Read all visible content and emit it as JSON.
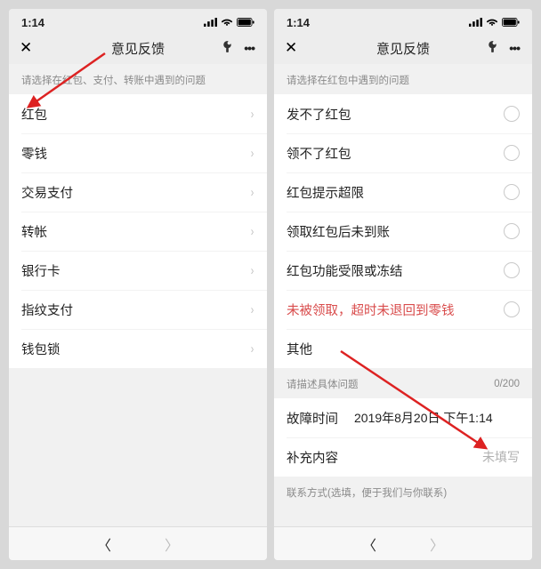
{
  "status": {
    "time": "1:14"
  },
  "nav": {
    "title": "意见反馈"
  },
  "left": {
    "section_header": "请选择在红包、支付、转账中遇到的问题",
    "items": [
      "红包",
      "零钱",
      "交易支付",
      "转帐",
      "银行卡",
      "指纹支付",
      "钱包锁"
    ]
  },
  "right": {
    "section_header": "请选择在红包中遇到的问题",
    "items": [
      "发不了红包",
      "领不了红包",
      "红包提示超限",
      "领取红包后未到账",
      "红包功能受限或冻结",
      "未被领取，超时未退回到零钱",
      "其他"
    ],
    "desc_header": "请描述具体问题",
    "counter": "0/200",
    "fault_time_label": "故障时间",
    "fault_time_value": "2019年8月20日 下午1:14",
    "supplement_label": "补充内容",
    "supplement_placeholder": "未填写",
    "contact_label": "联系方式(选填，便于我们与你联系)"
  }
}
